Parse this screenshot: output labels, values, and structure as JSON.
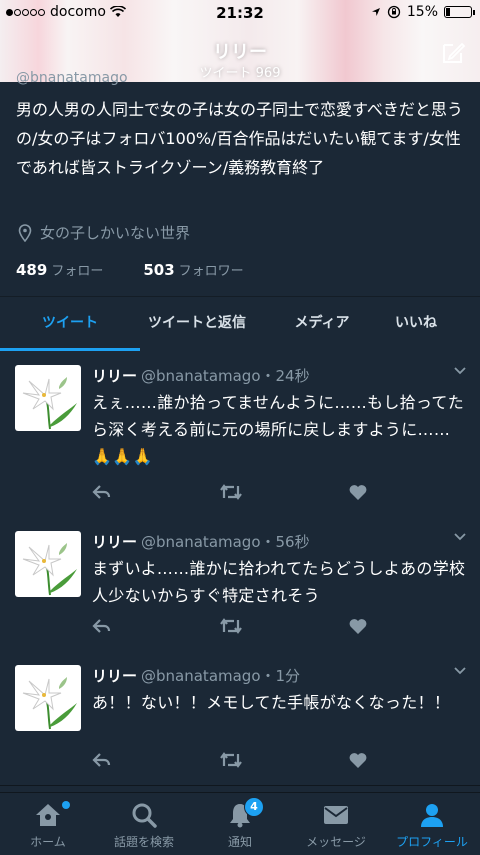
{
  "status_bar": {
    "carrier": "docomo",
    "time": "21:32",
    "battery": "15%",
    "battery_level": 0.15
  },
  "header": {
    "name": "リリー",
    "tweet_count": "ツイート 969",
    "handle_peek": "@bnanatamago"
  },
  "profile": {
    "bio": "男の人男の人同士で女の子は女の子同士で恋愛すべきだと思うの/女の子はフォロバ100%/百合作品はだいたい観てます/女性であれば皆ストライクゾーン/義務教育終了",
    "location": "女の子しかいない世界",
    "following_count": "489",
    "following_label": "フォロー",
    "followers_count": "503",
    "followers_label": "フォロワー"
  },
  "tabs": [
    "ツイート",
    "ツイートと返信",
    "メディア",
    "いいね"
  ],
  "tweets": [
    {
      "name": "リリー",
      "handle": "@bnanatamago",
      "time": "・24秒",
      "text": "えぇ……誰か拾ってませんように……もし拾ってたら深く考える前に元の場所に戻しますように……🙏🙏🙏"
    },
    {
      "name": "リリー",
      "handle": "@bnanatamago",
      "time": "・56秒",
      "text": "まずいよ……誰かに拾われてたらどうしよあの学校人少ないからすぐ特定されそう"
    },
    {
      "name": "リリー",
      "handle": "@bnanatamago",
      "time": "・1分",
      "text": "あ！！ない！！メモしてた手帳がなくなった！！"
    }
  ],
  "bottom_nav": {
    "home": "ホーム",
    "search": "話題を検索",
    "notifications": "通知",
    "notifications_badge": "4",
    "messages": "メッセージ",
    "profile": "プロフィール"
  },
  "colors": {
    "accent": "#1da1f2",
    "background": "#1b2836",
    "secondary_text": "#8899a6"
  }
}
